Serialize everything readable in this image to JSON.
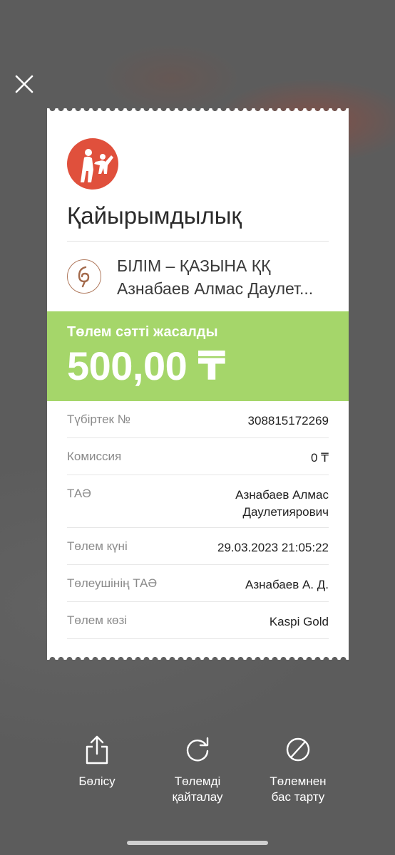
{
  "receipt": {
    "category": "Қайырымдылық",
    "org_name": "БІЛІМ – ҚАЗЫНА ҚҚ",
    "org_person": "Азнабаев Алмас Даулет...",
    "status": "Төлем сәтті жасалды",
    "amount": "500,00 ₸",
    "rows": [
      {
        "label": "Түбіртек №",
        "value": "308815172269"
      },
      {
        "label": "Комиссия",
        "value": "0 ₸"
      },
      {
        "label": "ТАӘ",
        "value_line1": "Азнабаев Алмас",
        "value_line2": "Даулетиярович"
      },
      {
        "label": "Төлем күні",
        "value": "29.03.2023 21:05:22"
      },
      {
        "label": "Төлеушінің ТАӘ",
        "value": "Азнабаев А. Д."
      },
      {
        "label": "Төлем көзі",
        "value": "Kaspi Gold"
      }
    ]
  },
  "actions": {
    "share": "Бөлісу",
    "repeat_line1": "Төлемді",
    "repeat_line2": "қайталау",
    "cancel_line1": "Төлемнен",
    "cancel_line2": "бас тарту"
  },
  "icons": {
    "close": "close-icon",
    "logo": "charity-logo",
    "org": "org-logo-icon",
    "share": "share-icon",
    "repeat": "repeat-icon",
    "cancel": "cancel-icon"
  },
  "colors": {
    "success_band": "#a5d66a",
    "logo_bg": "#e0503c",
    "overlay_bg": "#5c5c5c"
  }
}
